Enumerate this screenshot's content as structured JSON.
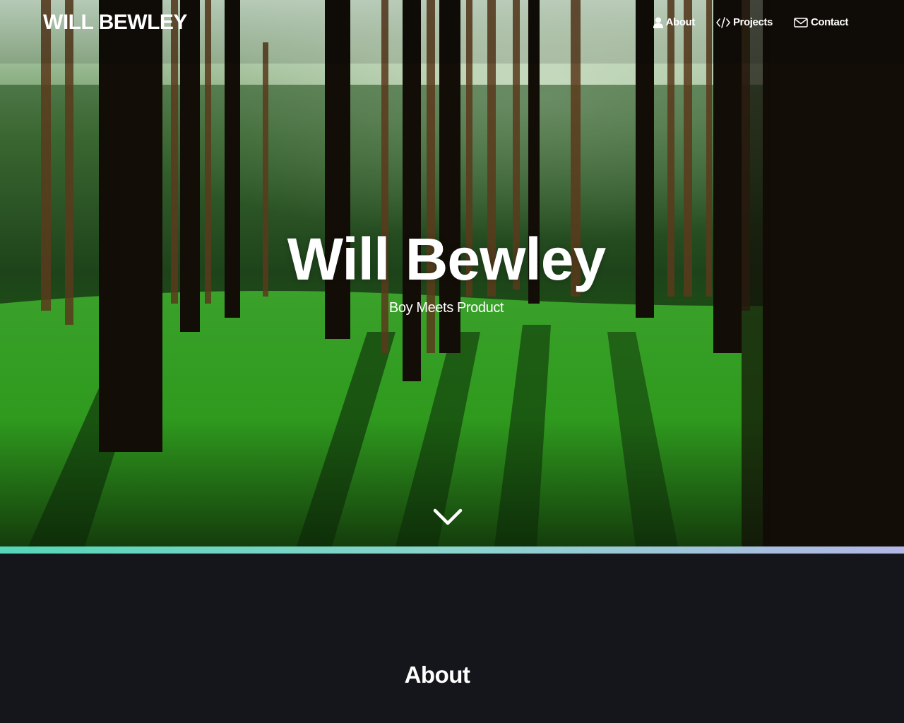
{
  "header": {
    "logo": "WILL BEWLEY",
    "nav": [
      {
        "label": "About",
        "icon": "user-icon"
      },
      {
        "label": "Projects",
        "icon": "code-icon"
      },
      {
        "label": "Contact",
        "icon": "envelope-icon"
      }
    ]
  },
  "hero": {
    "title": "Will Bewley",
    "subtitle": "Boy Meets Product",
    "scroll_icon": "chevron-down-icon",
    "background": "forest-photo"
  },
  "about": {
    "heading": "About"
  },
  "colors": {
    "page_background": "#15161b",
    "accent_gradient_start": "#55d6b8",
    "accent_gradient_end": "#b3b6e6",
    "text": "#ffffff"
  }
}
